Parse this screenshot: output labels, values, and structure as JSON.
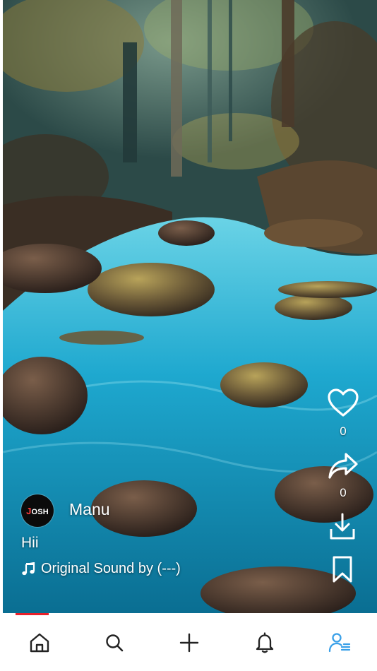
{
  "post": {
    "username": "Manu",
    "caption": "Hii",
    "sound_label": "Original Sound by (---)",
    "avatar_logo_text": "JOSH"
  },
  "actions": {
    "like_count": "0",
    "share_count": "0"
  },
  "progress": {
    "fraction": 0.13,
    "color": "#e8202a"
  },
  "bottom_nav": {
    "items": [
      {
        "name": "home",
        "icon": "home-icon"
      },
      {
        "name": "search",
        "icon": "search-icon"
      },
      {
        "name": "create",
        "icon": "plus-icon"
      },
      {
        "name": "notifications",
        "icon": "bell-icon"
      },
      {
        "name": "profile",
        "icon": "profile-icon",
        "active": true
      }
    ],
    "active_color": "#3aa0e8",
    "default_color": "#222222"
  }
}
